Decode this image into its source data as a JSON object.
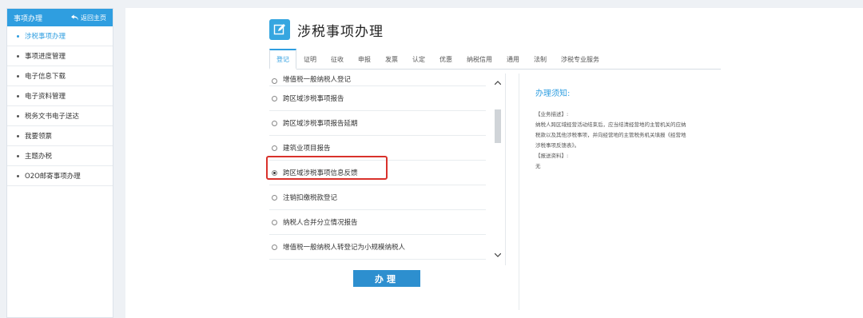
{
  "sidebar": {
    "title": "事项办理",
    "back_label": "返回主页",
    "items": [
      {
        "label": "涉税事项办理"
      },
      {
        "label": "事项进度管理"
      },
      {
        "label": "电子信息下载"
      },
      {
        "label": "电子资料管理"
      },
      {
        "label": "税务文书电子送达"
      },
      {
        "label": "我要领票"
      },
      {
        "label": "主题办税"
      },
      {
        "label": "O2O邮寄事项办理"
      }
    ]
  },
  "header": {
    "title": "涉税事项办理"
  },
  "tabs": [
    "登记",
    "证明",
    "征收",
    "申报",
    "发票",
    "认定",
    "优惠",
    "纳税信用",
    "通用",
    "法制",
    "涉税专业服务"
  ],
  "list": {
    "items": [
      {
        "label": "增值税一般纳税人登记"
      },
      {
        "label": "跨区域涉税事项报告"
      },
      {
        "label": "跨区域涉税事项报告延期"
      },
      {
        "label": "建筑业项目报告"
      },
      {
        "label": "跨区域涉税事项信息反馈"
      },
      {
        "label": "注销扣缴税款登记"
      },
      {
        "label": "纳税人合并分立情况报告"
      },
      {
        "label": "增值税一般纳税人转登记为小规模纳税人"
      }
    ],
    "selected_index": 4
  },
  "submit_label": "办理",
  "notice": {
    "title": "办理须知:",
    "lines": [
      "【业务描述】:",
      "纳税人跨区域经营活动结束后，应当结清经营地的主管机关的应纳",
      "税款以及其他涉税事项，并向经营地的主管税务机关填报《经营地",
      "涉税事项反馈表》。",
      "【报送资料】:",
      "无"
    ]
  },
  "colors": {
    "accent": "#2f9ee0",
    "button": "#2d8fcf",
    "highlight": "#d9312b"
  }
}
